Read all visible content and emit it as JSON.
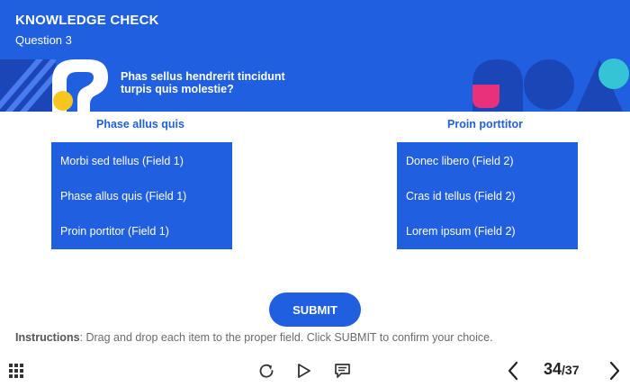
{
  "header": {
    "title": "KNOWLEDGE CHECK",
    "question_label": "Question 3",
    "prompt": "Phas sellus hendrerit tincidunt turpis quis molestie?"
  },
  "columns": [
    {
      "title": "Phase allus quis",
      "items": [
        "Morbi sed tellus (Field 1)",
        "Phase allus quis (Field 1)",
        "Proin portitor (Field 1)"
      ]
    },
    {
      "title": "Proin porttitor",
      "items": [
        "Donec libero (Field 2)",
        "Cras id tellus (Field 2)",
        "Lorem ipsum (Field 2)"
      ]
    }
  ],
  "submit_label": "SUBMIT",
  "instructions": {
    "label": "Instructions",
    "text": ": Drag and drop each item to the proper field. Click SUBMIT to confirm your choice."
  },
  "footer": {
    "current_page": "34",
    "total_pages": "/37",
    "icons": [
      "grid-menu-icon",
      "replay-icon",
      "play-icon",
      "transcript-icon",
      "chevron-left-icon",
      "chevron-right-icon"
    ]
  },
  "colors": {
    "primary": "#1f5fe0",
    "accent_pink": "#e8317a",
    "accent_yellow": "#f7c51e",
    "accent_cyan": "#35c4d6",
    "accent_navy": "#1a46b8"
  }
}
